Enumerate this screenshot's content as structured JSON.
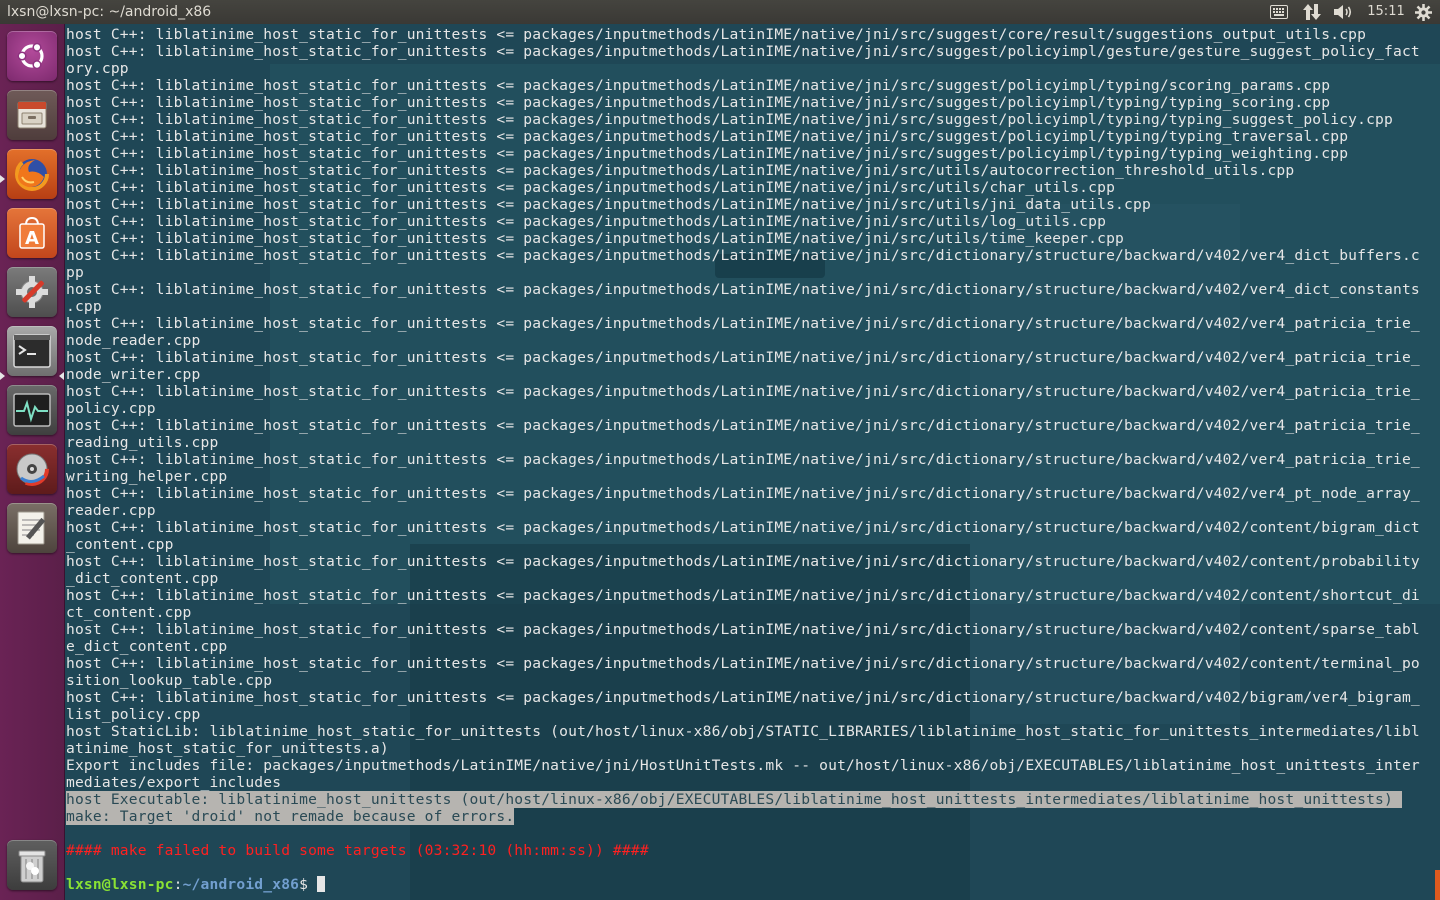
{
  "window": {
    "title": "lxsn@lxsn-pc: ~/android_x86"
  },
  "tray": {
    "keyboard_icon": "keyboard-icon",
    "network_icon": "network-updown-icon",
    "volume_icon": "volume-icon",
    "clock": "15:11",
    "settings_icon": "gear-icon"
  },
  "launcher": {
    "items": [
      {
        "name": "ubuntu-dash",
        "icon": "ubuntu-logo-icon"
      },
      {
        "name": "files",
        "icon": "file-cabinet-icon"
      },
      {
        "name": "firefox",
        "icon": "firefox-icon"
      },
      {
        "name": "software-center",
        "icon": "shopping-bag-icon"
      },
      {
        "name": "system-settings",
        "icon": "wrench-gear-icon"
      },
      {
        "name": "terminal",
        "icon": "terminal-prompt-icon"
      },
      {
        "name": "system-monitor",
        "icon": "heartbeat-icon"
      },
      {
        "name": "disc-burner",
        "icon": "disc-icon"
      },
      {
        "name": "text-editor",
        "icon": "notepad-pencil-icon"
      },
      {
        "name": "trash",
        "icon": "trash-icon"
      }
    ]
  },
  "terminal": {
    "lines": [
      "host C++: liblatinime_host_static_for_unittests <= packages/inputmethods/LatinIME/native/jni/src/suggest/core/result/suggestions_output_utils.cpp",
      "host C++: liblatinime_host_static_for_unittests <= packages/inputmethods/LatinIME/native/jni/src/suggest/policyimpl/gesture/gesture_suggest_policy_fact",
      "ory.cpp",
      "host C++: liblatinime_host_static_for_unittests <= packages/inputmethods/LatinIME/native/jni/src/suggest/policyimpl/typing/scoring_params.cpp",
      "host C++: liblatinime_host_static_for_unittests <= packages/inputmethods/LatinIME/native/jni/src/suggest/policyimpl/typing/typing_scoring.cpp",
      "host C++: liblatinime_host_static_for_unittests <= packages/inputmethods/LatinIME/native/jni/src/suggest/policyimpl/typing/typing_suggest_policy.cpp",
      "host C++: liblatinime_host_static_for_unittests <= packages/inputmethods/LatinIME/native/jni/src/suggest/policyimpl/typing/typing_traversal.cpp",
      "host C++: liblatinime_host_static_for_unittests <= packages/inputmethods/LatinIME/native/jni/src/suggest/policyimpl/typing/typing_weighting.cpp",
      "host C++: liblatinime_host_static_for_unittests <= packages/inputmethods/LatinIME/native/jni/src/utils/autocorrection_threshold_utils.cpp",
      "host C++: liblatinime_host_static_for_unittests <= packages/inputmethods/LatinIME/native/jni/src/utils/char_utils.cpp",
      "host C++: liblatinime_host_static_for_unittests <= packages/inputmethods/LatinIME/native/jni/src/utils/jni_data_utils.cpp",
      "host C++: liblatinime_host_static_for_unittests <= packages/inputmethods/LatinIME/native/jni/src/utils/log_utils.cpp",
      "host C++: liblatinime_host_static_for_unittests <= packages/inputmethods/LatinIME/native/jni/src/utils/time_keeper.cpp",
      "host C++: liblatinime_host_static_for_unittests <= packages/inputmethods/LatinIME/native/jni/src/dictionary/structure/backward/v402/ver4_dict_buffers.c",
      "pp",
      "host C++: liblatinime_host_static_for_unittests <= packages/inputmethods/LatinIME/native/jni/src/dictionary/structure/backward/v402/ver4_dict_constants",
      ".cpp",
      "host C++: liblatinime_host_static_for_unittests <= packages/inputmethods/LatinIME/native/jni/src/dictionary/structure/backward/v402/ver4_patricia_trie_",
      "node_reader.cpp",
      "host C++: liblatinime_host_static_for_unittests <= packages/inputmethods/LatinIME/native/jni/src/dictionary/structure/backward/v402/ver4_patricia_trie_",
      "node_writer.cpp",
      "host C++: liblatinime_host_static_for_unittests <= packages/inputmethods/LatinIME/native/jni/src/dictionary/structure/backward/v402/ver4_patricia_trie_",
      "policy.cpp",
      "host C++: liblatinime_host_static_for_unittests <= packages/inputmethods/LatinIME/native/jni/src/dictionary/structure/backward/v402/ver4_patricia_trie_",
      "reading_utils.cpp",
      "host C++: liblatinime_host_static_for_unittests <= packages/inputmethods/LatinIME/native/jni/src/dictionary/structure/backward/v402/ver4_patricia_trie_",
      "writing_helper.cpp",
      "host C++: liblatinime_host_static_for_unittests <= packages/inputmethods/LatinIME/native/jni/src/dictionary/structure/backward/v402/ver4_pt_node_array_",
      "reader.cpp",
      "host C++: liblatinime_host_static_for_unittests <= packages/inputmethods/LatinIME/native/jni/src/dictionary/structure/backward/v402/content/bigram_dict",
      "_content.cpp",
      "host C++: liblatinime_host_static_for_unittests <= packages/inputmethods/LatinIME/native/jni/src/dictionary/structure/backward/v402/content/probability",
      "_dict_content.cpp",
      "host C++: liblatinime_host_static_for_unittests <= packages/inputmethods/LatinIME/native/jni/src/dictionary/structure/backward/v402/content/shortcut_di",
      "ct_content.cpp",
      "host C++: liblatinime_host_static_for_unittests <= packages/inputmethods/LatinIME/native/jni/src/dictionary/structure/backward/v402/content/sparse_tabl",
      "e_dict_content.cpp",
      "host C++: liblatinime_host_static_for_unittests <= packages/inputmethods/LatinIME/native/jni/src/dictionary/structure/backward/v402/content/terminal_po",
      "sition_lookup_table.cpp",
      "host C++: liblatinime_host_static_for_unittests <= packages/inputmethods/LatinIME/native/jni/src/dictionary/structure/backward/v402/bigram/ver4_bigram_",
      "list_policy.cpp",
      "host StaticLib: liblatinime_host_static_for_unittests (out/host/linux-x86/obj/STATIC_LIBRARIES/liblatinime_host_static_for_unittests_intermediates/libl",
      "atinime_host_static_for_unittests.a)",
      "Export includes file: packages/inputmethods/LatinIME/native/jni/HostUnitTests.mk -- out/host/linux-x86/obj/EXECUTABLES/liblatinime_host_unittests_inter",
      "mediates/export_includes"
    ],
    "selected_lines": [
      "host Executable: liblatinime_host_unittests (out/host/linux-x86/obj/EXECUTABLES/liblatinime_host_unittests_intermediates/liblatinime_host_unittests) ",
      "make: Target 'droid' not remade because of errors."
    ],
    "error_line": "#### make failed to build some targets (03:32:10 (hh:mm:ss)) ####",
    "prompt": {
      "user_host": "lxsn@lxsn-pc",
      "sep": ":",
      "path": "~/android_x86",
      "symbol": "$ "
    }
  }
}
